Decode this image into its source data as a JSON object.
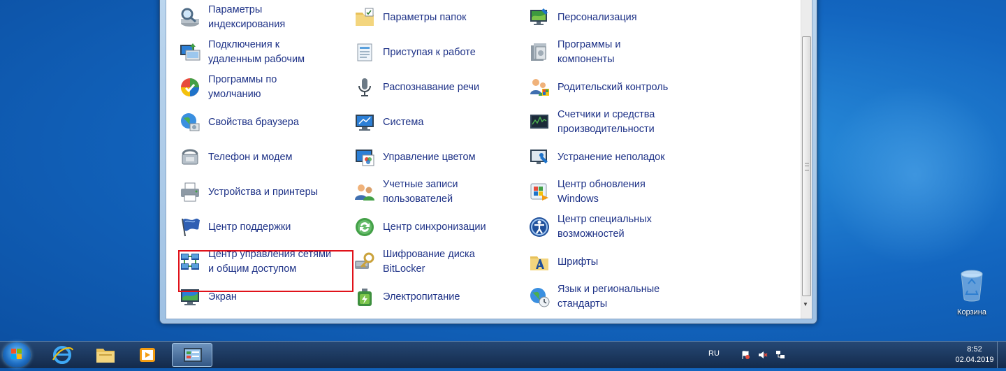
{
  "control_panel": {
    "items": [
      {
        "label": "Параметры\nиндексирования",
        "icon": "indexing-icon"
      },
      {
        "label": "Параметры папок",
        "icon": "folder-options-icon"
      },
      {
        "label": "Персонализация",
        "icon": "personalization-icon"
      },
      {
        "label": "Подключения к\nудаленным рабочим",
        "icon": "remote-desktop-icon"
      },
      {
        "label": "Приступая к работе",
        "icon": "getting-started-icon"
      },
      {
        "label": "Программы и\nкомпоненты",
        "icon": "programs-features-icon"
      },
      {
        "label": "Программы по\nумолчанию",
        "icon": "default-programs-icon"
      },
      {
        "label": "Распознавание речи",
        "icon": "microphone-icon"
      },
      {
        "label": "Родительский контроль",
        "icon": "parental-controls-icon"
      },
      {
        "label": "Свойства браузера",
        "icon": "internet-options-icon"
      },
      {
        "label": "Система",
        "icon": "system-icon"
      },
      {
        "label": "Счетчики и средства\nпроизводительности",
        "icon": "performance-icon"
      },
      {
        "label": "Телефон и модем",
        "icon": "phone-modem-icon"
      },
      {
        "label": "Управление цветом",
        "icon": "color-management-icon"
      },
      {
        "label": "Устранение неполадок",
        "icon": "troubleshooting-icon"
      },
      {
        "label": "Устройства и принтеры",
        "icon": "printer-icon"
      },
      {
        "label": "Учетные записи\nпользователей",
        "icon": "user-accounts-icon"
      },
      {
        "label": "Центр обновления\nWindows",
        "icon": "windows-update-icon"
      },
      {
        "label": "Центр поддержки",
        "icon": "action-center-flag-icon"
      },
      {
        "label": "Центр синхронизации",
        "icon": "sync-center-icon"
      },
      {
        "label": "Центр специальных\nвозможностей",
        "icon": "ease-of-access-icon"
      },
      {
        "label": "Центр управления сетями\nи общим доступом",
        "icon": "network-center-icon"
      },
      {
        "label": "Шифрование диска\nBitLocker",
        "icon": "bitlocker-key-icon"
      },
      {
        "label": "Шрифты",
        "icon": "fonts-folder-icon"
      },
      {
        "label": "Экран",
        "icon": "display-icon"
      },
      {
        "label": "Электропитание",
        "icon": "power-options-icon"
      },
      {
        "label": "Язык и региональные\nстандарты",
        "icon": "region-language-icon"
      }
    ]
  },
  "desktop": {
    "recycle_bin_label": "Корзина"
  },
  "taskbar": {
    "language": "RU",
    "time": "8:52",
    "date": "02.04.2019"
  },
  "colors": {
    "link_text": "#1e3287",
    "highlight_box": "#e0121a"
  }
}
